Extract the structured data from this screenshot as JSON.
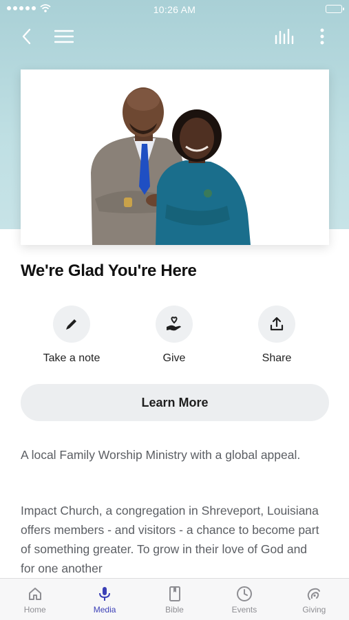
{
  "status_bar": {
    "time": "10:26 AM"
  },
  "hero": {
    "title": "We're Glad You're Here"
  },
  "actions": [
    {
      "label": "Take a note",
      "icon": "pencil-icon"
    },
    {
      "label": "Give",
      "icon": "heart-hand-icon"
    },
    {
      "label": "Share",
      "icon": "share-icon"
    }
  ],
  "learn_more_label": "Learn More",
  "description": {
    "intro": "A local Family Worship Ministry with a global appeal.",
    "body": "Impact Church, a congregation in Shreveport, Louisiana offers members - and visitors - a chance to become part of something greater. To grow in their love of God and for one another"
  },
  "tabs": [
    {
      "label": "Home",
      "icon": "home-icon",
      "active": false
    },
    {
      "label": "Media",
      "icon": "microphone-icon",
      "active": true
    },
    {
      "label": "Bible",
      "icon": "bible-icon",
      "active": false
    },
    {
      "label": "Events",
      "icon": "clock-icon",
      "active": false
    },
    {
      "label": "Giving",
      "icon": "giving-icon",
      "active": false
    }
  ],
  "colors": {
    "accent": "#3b3fb6",
    "hero_bg": "#b9dce1",
    "tab_inactive": "#8e8e93"
  }
}
